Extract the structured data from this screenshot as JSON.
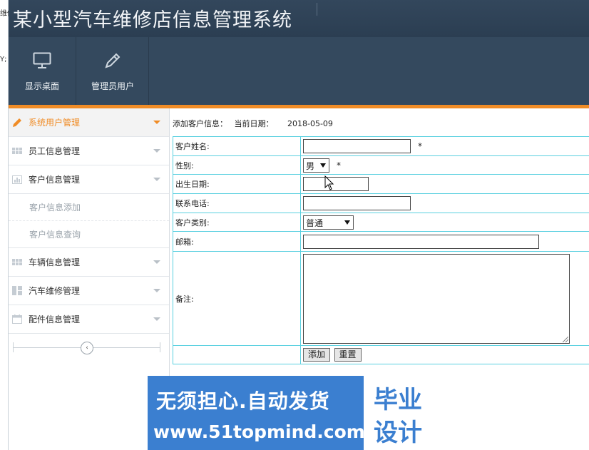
{
  "edge_fragments": [
    "维修",
    "Y;"
  ],
  "app": {
    "title": "某小型汽车维修店信息管理系统"
  },
  "toolbar": {
    "items": [
      {
        "label": "显示桌面",
        "icon": "monitor-icon"
      },
      {
        "label": "管理员用户",
        "icon": "pencil-icon"
      }
    ]
  },
  "sidebar": {
    "items": [
      {
        "label": "系统用户管理",
        "icon": "pencil-icon",
        "active": true
      },
      {
        "label": "员工信息管理",
        "icon": "grid-icon"
      },
      {
        "label": "客户信息管理",
        "icon": "chart-icon"
      },
      {
        "label": "车辆信息管理",
        "icon": "grid-icon"
      },
      {
        "label": "汽车维修管理",
        "icon": "columns-icon"
      },
      {
        "label": "配件信息管理",
        "icon": "calendar-icon"
      }
    ],
    "subitems": [
      "客户信息添加",
      "客户信息查询"
    ],
    "collapse_glyph": "‹"
  },
  "crumb": {
    "section": "添加客户信息：",
    "date_label": "当前日期：",
    "date": "2018-05-09"
  },
  "form": {
    "name_label": "客户姓名:",
    "name_value": "",
    "gender_label": "性别:",
    "gender_value": "男",
    "birth_label": "出生日期:",
    "birth_value": "",
    "phone_label": "联系电话:",
    "phone_value": "",
    "type_label": "客户类别:",
    "type_value": "普通",
    "email_label": "邮箱:",
    "email_value": "",
    "remark_label": "备注:",
    "remark_value": "",
    "required_mark": "*",
    "add_button": "添加",
    "reset_button": "重置"
  },
  "banner": {
    "line1": "无须担心.自动发货",
    "line2": "www.51topmind.com",
    "box_line1": "毕业",
    "box_line2": "设计"
  },
  "colors": {
    "header": "#2f4358",
    "accent": "#f08c26",
    "table_border": "#5ad0e0",
    "banner": "#3b7fd0"
  }
}
